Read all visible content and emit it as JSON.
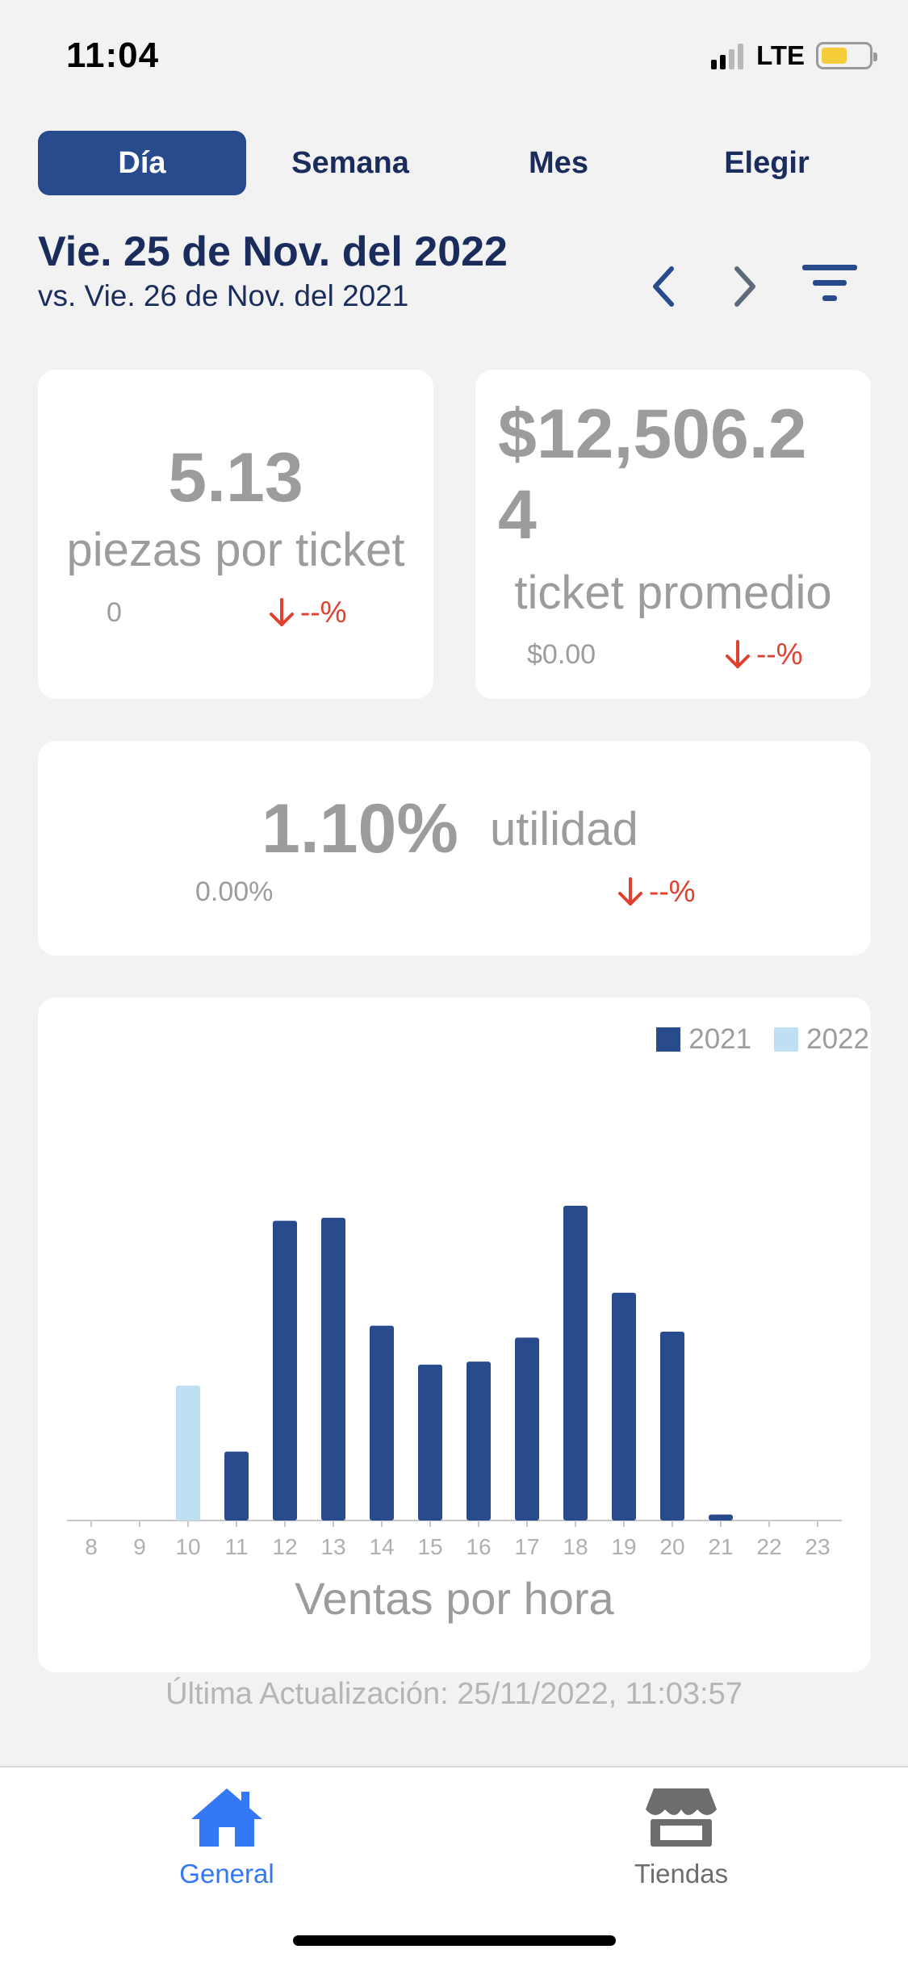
{
  "status": {
    "time": "11:04",
    "network": "LTE"
  },
  "tabs": [
    "Día",
    "Semana",
    "Mes",
    "Elegir"
  ],
  "date": {
    "main": "Vie. 25 de Nov. del 2022",
    "compare": "vs. Vie. 26 de Nov. del 2021"
  },
  "icons": {
    "prev": "chevron-left-icon",
    "next": "chevron-right-icon",
    "filter": "filter-icon"
  },
  "colors": {
    "accent": "#274b8c",
    "series_2021": "#274b8c",
    "series_2022": "#bde0f3",
    "negative": "#e0412f",
    "muted": "#9c9c9c"
  },
  "kpis": {
    "pieces": {
      "value": "5.13",
      "label": "piezas por ticket",
      "previous": "0",
      "delta": "--%"
    },
    "ticket": {
      "value_line1": "$12,506.2",
      "value_line2": "4",
      "label": "ticket promedio",
      "previous": "$0.00",
      "delta": "--%"
    },
    "margin": {
      "value": "1.10%",
      "label": "utilidad",
      "previous": "0.00%",
      "delta": "--%"
    }
  },
  "chart_data": {
    "type": "bar",
    "title": "Ventas por hora",
    "categories": [
      "8",
      "9",
      "10",
      "11",
      "12",
      "13",
      "14",
      "15",
      "16",
      "17",
      "18",
      "19",
      "20",
      "21",
      "22",
      "23"
    ],
    "series": [
      {
        "name": "2021",
        "values": [
          0,
          0,
          0,
          23,
          100,
          101,
          65,
          52,
          53,
          61,
          105,
          76,
          63,
          2,
          0,
          0
        ]
      },
      {
        "name": "2022",
        "values": [
          0,
          0,
          45,
          0,
          0,
          0,
          0,
          0,
          0,
          0,
          0,
          0,
          0,
          0,
          0,
          0
        ]
      }
    ],
    "legend": "top-right",
    "grid": false
  },
  "footer": {
    "last_update": "Última Actualización: 25/11/2022, 11:03:57"
  },
  "tabbar": [
    {
      "label": "General",
      "icon": "home-icon",
      "active": true
    },
    {
      "label": "Tiendas",
      "icon": "store-icon",
      "active": false
    }
  ]
}
